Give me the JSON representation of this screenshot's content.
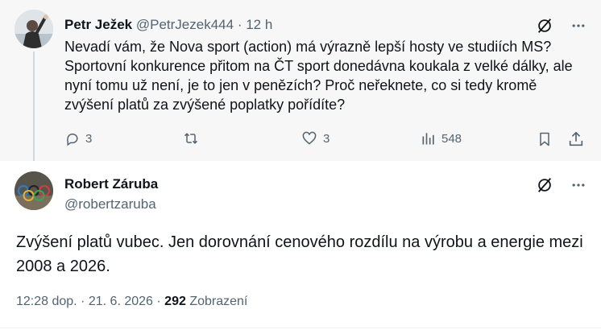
{
  "parent": {
    "author_name": "Petr Ježek",
    "author_handle": "@PetrJezek444",
    "separator": "·",
    "time": "12 h",
    "text": "Nevadí vám, že Nova sport (action) má výrazně lepší hosty ve studiích MS? Sportovní konkurence přitom na ČT sport donedávna koukala z velké dálky, ale nyní tomu už není, je to jen v penězích? Proč neřeknete, co si tedy kromě zvýšení platů za zvýšené poplatky pořídíte?",
    "replies": "3",
    "likes": "3",
    "views": "548"
  },
  "reply": {
    "author_name": "Robert Záruba",
    "author_handle": "@robertzaruba",
    "text": "Zvýšení platů vubec. Jen dorovnání cenového rozdílu na výrobu a energie mezi 2008 a 2026.",
    "time": "12:28 dop.",
    "dot": "·",
    "date": "21. 6. 2026",
    "dot2": "·",
    "views": "292",
    "views_label": "Zobrazení"
  },
  "icons": {
    "grok": "grok-icon",
    "more": "more-icon",
    "reply": "reply-icon",
    "retweet": "retweet-icon",
    "like": "heart-icon",
    "views": "views-icon",
    "bookmark": "bookmark-icon",
    "share": "share-icon"
  },
  "colors": {
    "text": "#0f1419",
    "muted": "#536471",
    "parent_bg": "#f7f7f7"
  }
}
